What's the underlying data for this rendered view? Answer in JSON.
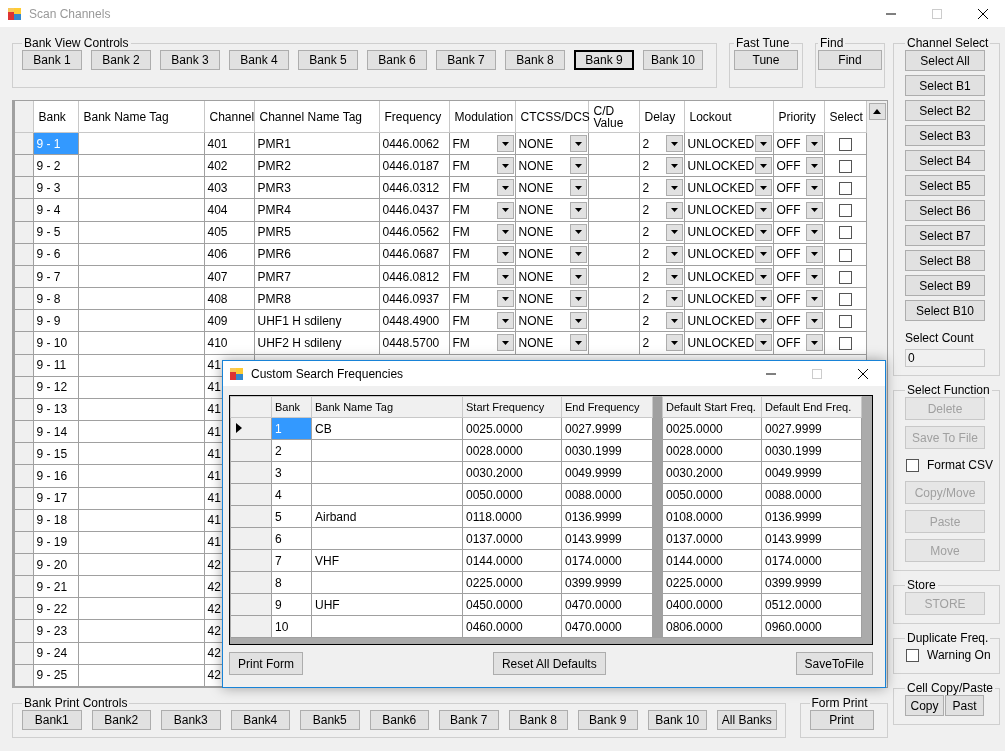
{
  "window": {
    "title": "Scan Channels"
  },
  "bank_view_controls": {
    "label": "Bank View Controls",
    "buttons": [
      {
        "label": "Bank 1",
        "selected": false
      },
      {
        "label": "Bank 2",
        "selected": false
      },
      {
        "label": "Bank 3",
        "selected": false
      },
      {
        "label": "Bank 4",
        "selected": false
      },
      {
        "label": "Bank 5",
        "selected": false
      },
      {
        "label": "Bank 6",
        "selected": false
      },
      {
        "label": "Bank 7",
        "selected": false
      },
      {
        "label": "Bank 8",
        "selected": false
      },
      {
        "label": "Bank 9",
        "selected": true
      },
      {
        "label": "Bank 10",
        "selected": false
      }
    ]
  },
  "fast_tune": {
    "label": "Fast Tune",
    "button": "Tune"
  },
  "find": {
    "label": "Find",
    "button": "Find"
  },
  "channel_grid": {
    "columns": [
      "Bank",
      "Bank Name Tag",
      "Channel",
      "Channel Name Tag",
      "Frequency",
      "Modulation",
      "CTCSS/DCS",
      "C/D Value",
      "Delay",
      "Lockout",
      "Priority",
      "Select"
    ],
    "rows": [
      {
        "selected": true,
        "bank": "9 - 1",
        "channel": "401",
        "channel_name_tag": "PMR1",
        "frequency": "0446.0062",
        "modulation": "FM",
        "ctcss_dcs": "NONE",
        "delay": "2",
        "lockout": "UNLOCKED",
        "priority": "OFF",
        "select": false
      },
      {
        "selected": false,
        "bank": "9 - 2",
        "channel": "402",
        "channel_name_tag": "PMR2",
        "frequency": "0446.0187",
        "modulation": "FM",
        "ctcss_dcs": "NONE",
        "delay": "2",
        "lockout": "UNLOCKED",
        "priority": "OFF",
        "select": false
      },
      {
        "selected": false,
        "bank": "9 - 3",
        "channel": "403",
        "channel_name_tag": "PMR3",
        "frequency": "0446.0312",
        "modulation": "FM",
        "ctcss_dcs": "NONE",
        "delay": "2",
        "lockout": "UNLOCKED",
        "priority": "OFF",
        "select": false
      },
      {
        "selected": false,
        "bank": "9 - 4",
        "channel": "404",
        "channel_name_tag": "PMR4",
        "frequency": "0446.0437",
        "modulation": "FM",
        "ctcss_dcs": "NONE",
        "delay": "2",
        "lockout": "UNLOCKED",
        "priority": "OFF",
        "select": false
      },
      {
        "selected": false,
        "bank": "9 - 5",
        "channel": "405",
        "channel_name_tag": "PMR5",
        "frequency": "0446.0562",
        "modulation": "FM",
        "ctcss_dcs": "NONE",
        "delay": "2",
        "lockout": "UNLOCKED",
        "priority": "OFF",
        "select": false
      },
      {
        "selected": false,
        "bank": "9 - 6",
        "channel": "406",
        "channel_name_tag": "PMR6",
        "frequency": "0446.0687",
        "modulation": "FM",
        "ctcss_dcs": "NONE",
        "delay": "2",
        "lockout": "UNLOCKED",
        "priority": "OFF",
        "select": false
      },
      {
        "selected": false,
        "bank": "9 - 7",
        "channel": "407",
        "channel_name_tag": "PMR7",
        "frequency": "0446.0812",
        "modulation": "FM",
        "ctcss_dcs": "NONE",
        "delay": "2",
        "lockout": "UNLOCKED",
        "priority": "OFF",
        "select": false
      },
      {
        "selected": false,
        "bank": "9 - 8",
        "channel": "408",
        "channel_name_tag": "PMR8",
        "frequency": "0446.0937",
        "modulation": "FM",
        "ctcss_dcs": "NONE",
        "delay": "2",
        "lockout": "UNLOCKED",
        "priority": "OFF",
        "select": false
      },
      {
        "selected": false,
        "bank": "9 - 9",
        "channel": "409",
        "channel_name_tag": "UHF1 H sdileny",
        "frequency": "0448.4900",
        "modulation": "FM",
        "ctcss_dcs": "NONE",
        "delay": "2",
        "lockout": "UNLOCKED",
        "priority": "OFF",
        "select": false
      },
      {
        "selected": false,
        "bank": "9 - 10",
        "channel": "410",
        "channel_name_tag": "UHF2 H sdileny",
        "frequency": "0448.5700",
        "modulation": "FM",
        "ctcss_dcs": "NONE",
        "delay": "2",
        "lockout": "UNLOCKED",
        "priority": "OFF",
        "select": false
      },
      {
        "selected": false,
        "bank": "9 - 11",
        "channel": "41"
      },
      {
        "selected": false,
        "bank": "9 - 12",
        "channel": "41"
      },
      {
        "selected": false,
        "bank": "9 - 13",
        "channel": "41"
      },
      {
        "selected": false,
        "bank": "9 - 14",
        "channel": "41"
      },
      {
        "selected": false,
        "bank": "9 - 15",
        "channel": "41"
      },
      {
        "selected": false,
        "bank": "9 - 16",
        "channel": "41"
      },
      {
        "selected": false,
        "bank": "9 - 17",
        "channel": "41"
      },
      {
        "selected": false,
        "bank": "9 - 18",
        "channel": "41"
      },
      {
        "selected": false,
        "bank": "9 - 19",
        "channel": "41"
      },
      {
        "selected": false,
        "bank": "9 - 20",
        "channel": "42"
      },
      {
        "selected": false,
        "bank": "9 - 21",
        "channel": "42"
      },
      {
        "selected": false,
        "bank": "9 - 22",
        "channel": "42"
      },
      {
        "selected": false,
        "bank": "9 - 23",
        "channel": "42"
      },
      {
        "selected": false,
        "bank": "9 - 24",
        "channel": "42"
      },
      {
        "selected": false,
        "bank": "9 - 25",
        "channel": "42"
      }
    ]
  },
  "channel_select": {
    "label": "Channel Select",
    "buttons": [
      "Select All",
      "Select B1",
      "Select B2",
      "Select B3",
      "Select B4",
      "Select B5",
      "Select B6",
      "Select B7",
      "Select B8",
      "Select B9",
      "Select B10"
    ],
    "count_label": "Select Count",
    "count_value": "0"
  },
  "select_function": {
    "label": "Select Function",
    "items": [
      {
        "kind": "button",
        "label": "Delete",
        "disabled": true
      },
      {
        "kind": "button",
        "label": "Save To File",
        "disabled": true
      },
      {
        "kind": "checkbox",
        "label": "Format CSV",
        "checked": false
      },
      {
        "kind": "button",
        "label": "Copy/Move",
        "disabled": true
      },
      {
        "kind": "button",
        "label": "Paste",
        "disabled": true
      },
      {
        "kind": "button",
        "label": "Move",
        "disabled": true
      }
    ]
  },
  "store": {
    "label": "Store",
    "button": {
      "label": "STORE",
      "disabled": true
    }
  },
  "duplicate_freq": {
    "label": "Duplicate Freq.",
    "checkbox": {
      "label": "Warning On",
      "checked": false
    }
  },
  "cell_copy_paste": {
    "label": "Cell Copy/Paste",
    "buttons": [
      "Copy",
      "Past"
    ]
  },
  "bank_print_controls": {
    "label": "Bank Print Controls",
    "buttons": [
      "Bank1",
      "Bank2",
      "Bank3",
      "Bank4",
      "Bank5",
      "Bank6",
      "Bank 7",
      "Bank 8",
      "Bank 9",
      "Bank 10",
      "All Banks"
    ]
  },
  "form_print": {
    "label": "Form Print",
    "button": "Print"
  },
  "dialog": {
    "title": "Custom Search Frequencies",
    "columns": [
      "Bank",
      "Bank Name Tag",
      "Start Frequency",
      "End Frequency",
      "Default Start Freq.",
      "Default End Freq."
    ],
    "rows": [
      {
        "selected": true,
        "bank": "1",
        "bank_name_tag": "CB",
        "start_frequency": "0025.0000",
        "end_frequency": "0027.9999",
        "default_start": "0025.0000",
        "default_end": "0027.9999"
      },
      {
        "selected": false,
        "bank": "2",
        "start_frequency": "0028.0000",
        "end_frequency": "0030.1999",
        "default_start": "0028.0000",
        "default_end": "0030.1999"
      },
      {
        "selected": false,
        "bank": "3",
        "start_frequency": "0030.2000",
        "end_frequency": "0049.9999",
        "default_start": "0030.2000",
        "default_end": "0049.9999"
      },
      {
        "selected": false,
        "bank": "4",
        "start_frequency": "0050.0000",
        "end_frequency": "0088.0000",
        "default_start": "0050.0000",
        "default_end": "0088.0000"
      },
      {
        "selected": false,
        "bank": "5",
        "bank_name_tag": "Airband",
        "start_frequency": "0118.0000",
        "end_frequency": "0136.9999",
        "default_start": "0108.0000",
        "default_end": "0136.9999"
      },
      {
        "selected": false,
        "bank": "6",
        "start_frequency": "0137.0000",
        "end_frequency": "0143.9999",
        "default_start": "0137.0000",
        "default_end": "0143.9999"
      },
      {
        "selected": false,
        "bank": "7",
        "bank_name_tag": "VHF",
        "start_frequency": "0144.0000",
        "end_frequency": "0174.0000",
        "default_start": "0144.0000",
        "default_end": "0174.0000"
      },
      {
        "selected": false,
        "bank": "8",
        "start_frequency": "0225.0000",
        "end_frequency": "0399.9999",
        "default_start": "0225.0000",
        "default_end": "0399.9999"
      },
      {
        "selected": false,
        "bank": "9",
        "bank_name_tag": "UHF",
        "start_frequency": "0450.0000",
        "end_frequency": "0470.0000",
        "default_start": "0400.0000",
        "default_end": "0512.0000"
      },
      {
        "selected": false,
        "bank": "10",
        "start_frequency": "0460.0000",
        "end_frequency": "0470.0000",
        "default_start": "0806.0000",
        "default_end": "0960.0000"
      }
    ],
    "buttons": [
      "Print Form",
      "Reset All Defaults",
      "SaveToFile"
    ]
  }
}
